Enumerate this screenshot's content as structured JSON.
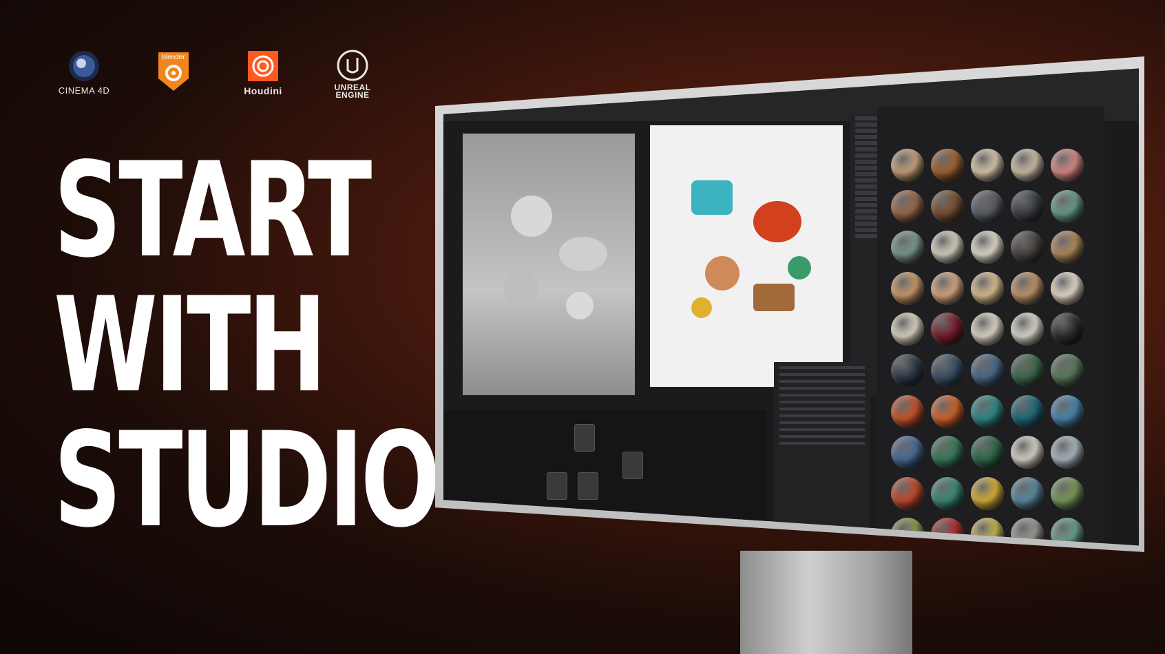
{
  "logos": [
    {
      "label": "CINEMA 4D",
      "icon": "cinema4d-icon"
    },
    {
      "label": "blender",
      "icon": "blender-icon"
    },
    {
      "label": "Houdini",
      "icon": "houdini-icon"
    },
    {
      "label": "UNREAL ENGINE",
      "icon": "unreal-engine-icon"
    }
  ],
  "headline": [
    "START",
    "WITH",
    "STUDIO"
  ],
  "colors": {
    "background": "#1c0c08",
    "accent_glow": "#7a2a14",
    "headline_text": "#ffffff",
    "blender_orange": "#f2841c",
    "houdini_orange": "#ff5a1f"
  },
  "material_colors": [
    "#c9a27a",
    "#a0622f",
    "#d9c8ac",
    "#cdbfa6",
    "#d88a83",
    "#9a6a4a",
    "#7a5032",
    "#5a5e66",
    "#3c3f46",
    "#6a9c88",
    "#7a9a8c",
    "#d9d2c3",
    "#e2dccd",
    "#4a4440",
    "#b08a5c",
    "#c89a6a",
    "#d6a880",
    "#dcc090",
    "#c0956a",
    "#e6dccb",
    "#dcd4c2",
    "#7a1c2a",
    "#e0d8c8",
    "#dcd8cc",
    "#2e2c2a",
    "#2f3a48",
    "#3a5068",
    "#4a6a8a",
    "#3e6a4a",
    "#5a7a5a",
    "#c8532a",
    "#d0642c",
    "#2f8a8a",
    "#1f6a7a",
    "#4a86b0",
    "#4a6a9a",
    "#3a7a5a",
    "#2f6a4a",
    "#d8d4c8",
    "#aab8c0",
    "#c24a2a",
    "#3c8a7a",
    "#d8b03a",
    "#5a8aa0",
    "#7a9a5a",
    "#8a9a4a",
    "#b02a2a",
    "#c8b850",
    "#9a9a94",
    "#6aa090"
  ]
}
